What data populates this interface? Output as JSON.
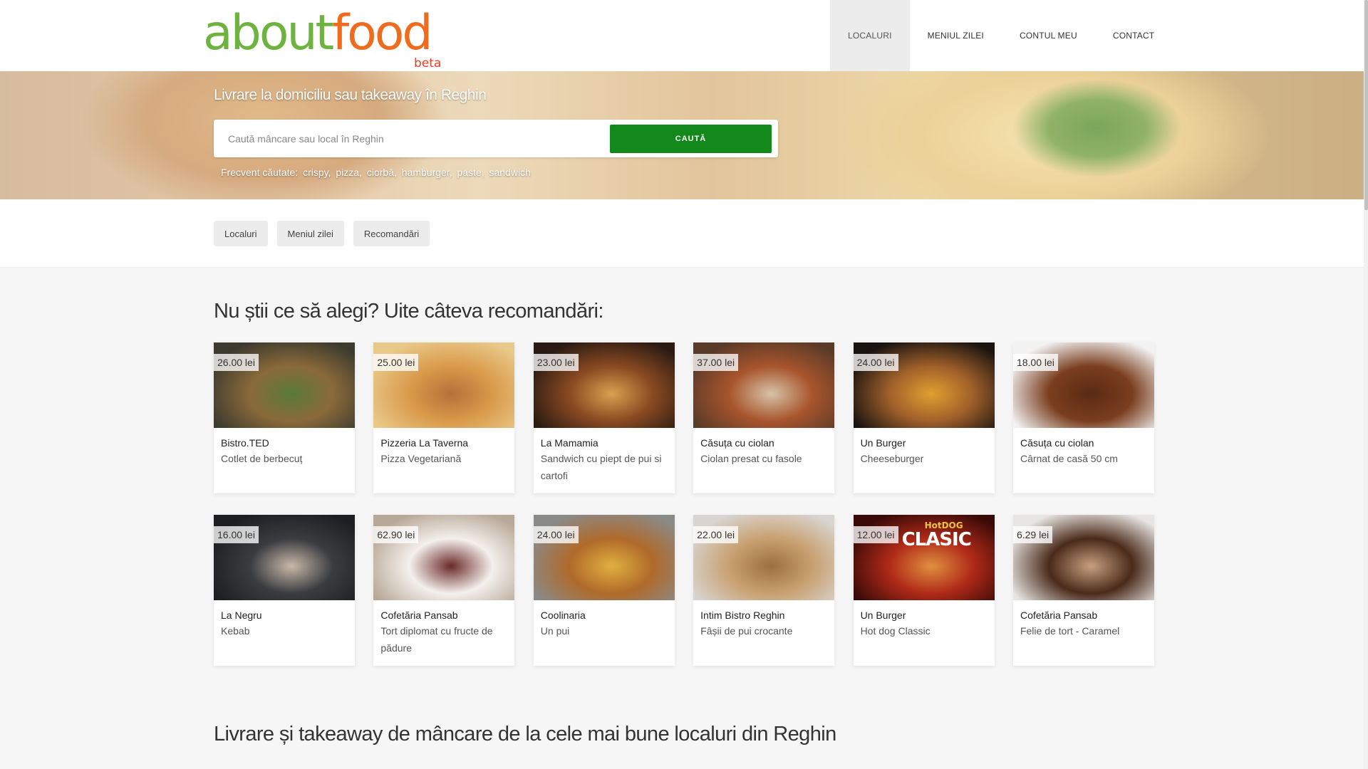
{
  "logo": {
    "about": "about",
    "food": "food",
    "beta": "beta"
  },
  "nav": [
    {
      "label": "LOCALURI",
      "active": true
    },
    {
      "label": "MENIUL ZILEI",
      "active": false
    },
    {
      "label": "CONTUL MEU",
      "active": false
    },
    {
      "label": "CONTACT",
      "active": false
    }
  ],
  "hero": {
    "title": "Livrare la domiciliu sau takeaway în Reghin",
    "search_placeholder": "Caută mâncare sau local în Reghin",
    "search_button": "CAUTĂ",
    "frequent_label": "Frecvent căutate:",
    "frequent_terms": [
      "crispy,",
      "pizza,",
      "ciorbă,",
      "hamburger,",
      "paste,",
      "sandwich"
    ]
  },
  "tabs": [
    "Localuri",
    "Meniul zilei",
    "Recomandări"
  ],
  "recommendations": {
    "title": "Nu știi ce să alegi? Uite câteva recomandări:",
    "items": [
      {
        "price": "26.00 lei",
        "place": "Bistro.TED",
        "dish": "Cotlet de berbecuț",
        "img_colors": [
          "#3d3a2e",
          "#8a6a3a",
          "#5a7a3a"
        ]
      },
      {
        "price": "25.00 lei",
        "place": "Pizzeria La Taverna",
        "dish": "Pizza Vegetariană",
        "img_colors": [
          "#e9c98a",
          "#d99a4a",
          "#b5703a"
        ]
      },
      {
        "price": "23.00 lei",
        "place": "La Mamamia",
        "dish": "Sandwich cu piept de pui si cartofi",
        "img_colors": [
          "#2a1a12",
          "#8a4a22",
          "#d9a050"
        ]
      },
      {
        "price": "37.00 lei",
        "place": "Căsuța cu ciolan",
        "dish": "Ciolan presat cu fasole",
        "img_colors": [
          "#5a3a28",
          "#a8552c",
          "#d6c3a8"
        ]
      },
      {
        "price": "24.00 lei",
        "place": "Un Burger",
        "dish": "Cheeseburger",
        "img_colors": [
          "#1a1410",
          "#a0602a",
          "#e0a030"
        ]
      },
      {
        "price": "18.00 lei",
        "place": "Căsuța cu ciolan",
        "dish": "Cârnat de casă 50 cm",
        "img_colors": [
          "#f2f2f2",
          "#7a3e1e",
          "#5a2a14"
        ]
      },
      {
        "price": "16.00 lei",
        "place": "La Negru",
        "dish": "Kebab",
        "img_colors": [
          "#1c1e22",
          "#3a3c40",
          "#c8b8a8"
        ]
      },
      {
        "price": "62.90 lei",
        "place": "Cofetăria Pansab",
        "dish": "Tort diplomat cu fructe de pădure",
        "img_colors": [
          "#b8a898",
          "#f4f0ec",
          "#6a2a2a"
        ]
      },
      {
        "price": "24.00 lei",
        "place": "Coolinaria",
        "dish": "Un pui",
        "img_colors": [
          "#8a8a88",
          "#b06a2a",
          "#e0b040"
        ]
      },
      {
        "price": "22.00 lei",
        "place": "Intim Bistro Reghin",
        "dish": "Fâșii de pui crocante",
        "img_colors": [
          "#d8d4d0",
          "#c8a070",
          "#9a7040"
        ]
      },
      {
        "price": "12.00 lei",
        "place": "Un Burger",
        "dish": "Hot dog Classic",
        "img_colors": [
          "#3a0a08",
          "#b02a18",
          "#e09040"
        ],
        "overlay_top": "HotDOG",
        "overlay_main": "CLASIC"
      },
      {
        "price": "6.29 lei",
        "place": "Cofetăria Pansab",
        "dish": "Felie de tort - Caramel",
        "img_colors": [
          "#e8e6e4",
          "#4a2a1a",
          "#c8a080"
        ]
      }
    ]
  },
  "section2_title": "Livrare și takeaway de mâncare de la cele mai bune localuri din Reghin"
}
